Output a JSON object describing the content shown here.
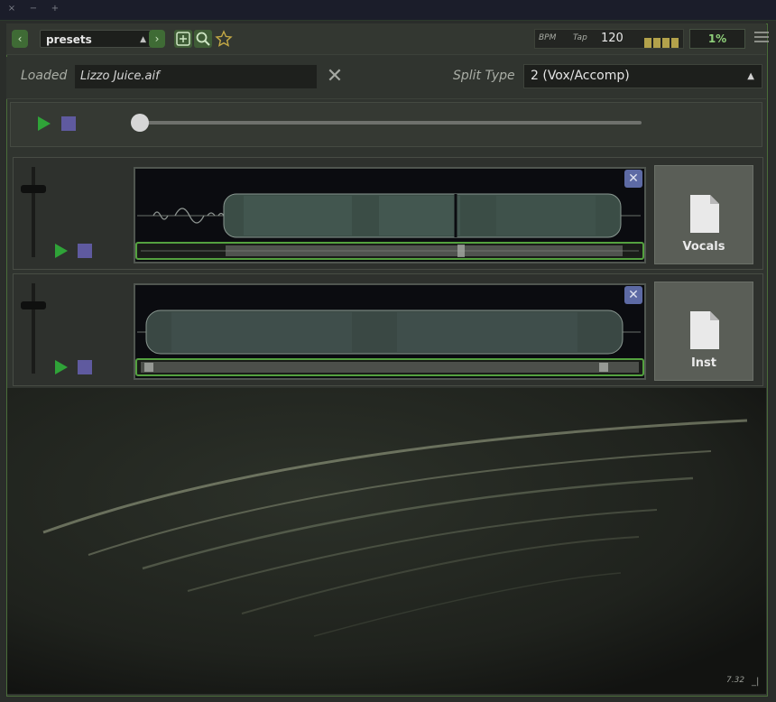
{
  "titlebar": {
    "buttons": [
      "×",
      "−",
      "+"
    ]
  },
  "toolbar": {
    "prev_label": "‹",
    "next_label": "›",
    "preset": "presets",
    "bpm_label": "BPM",
    "tap_label": "Tap",
    "bpm_value": "120",
    "tap_indicator_count": 4,
    "percent": "1%"
  },
  "loaded": {
    "label": "Loaded",
    "file": "Lizzo Juice.aif",
    "split_label": "Split Type",
    "split_value": "2 (Vox/Accomp)"
  },
  "transport": {
    "position": 0
  },
  "tracks": [
    {
      "stem": "Vocals"
    },
    {
      "stem": "Inst"
    }
  ],
  "footer": {
    "version": "7.32",
    "resize": "_|"
  },
  "colors": {
    "accent_green": "#3f6b35",
    "play_green": "#2fa338",
    "stop_purple": "#5f5a9f",
    "tap_yellow": "#b3a24b"
  },
  "icons": [
    "add-icon",
    "search-icon",
    "star-icon",
    "hamburger-menu-icon",
    "close-icon",
    "document-icon",
    "play-icon",
    "stop-icon"
  ]
}
